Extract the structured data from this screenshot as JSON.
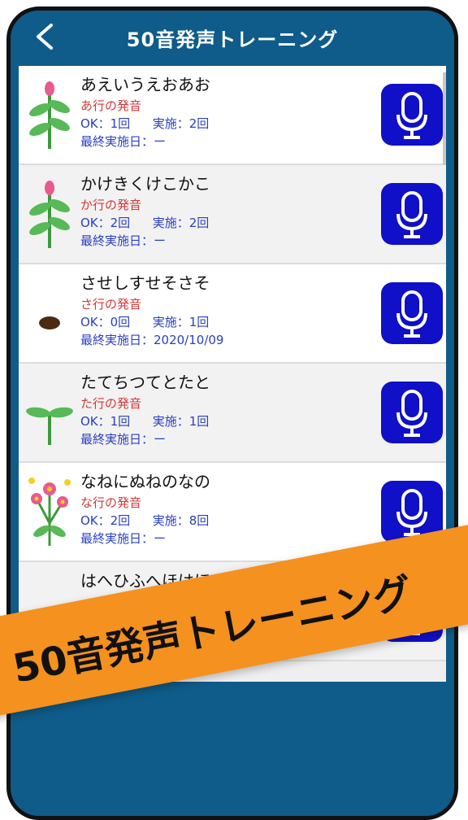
{
  "header": {
    "title": "50音発声トレーニング"
  },
  "items": [
    {
      "kana": "あえいうえおあお",
      "row_label": "あ行の発音",
      "ok": "OK：1回",
      "done": "実施：2回",
      "last": "最終実施日：ー"
    },
    {
      "kana": "かけきくけこかこ",
      "row_label": "か行の発音",
      "ok": "OK：2回",
      "done": "実施：2回",
      "last": "最終実施日：ー"
    },
    {
      "kana": "させしすせそさそ",
      "row_label": "さ行の発音",
      "ok": "OK：0回",
      "done": "実施：1回",
      "last": "最終実施日：2020/10/09"
    },
    {
      "kana": "たてちつてとたと",
      "row_label": "た行の発音",
      "ok": "OK：1回",
      "done": "実施：1回",
      "last": "最終実施日：ー"
    },
    {
      "kana": "なねにぬねのなの",
      "row_label": "な行の発音",
      "ok": "OK：2回",
      "done": "実施：8回",
      "last": "最終実施日：ー"
    },
    {
      "kana": "はへひふへほはほ"
    }
  ],
  "banner": {
    "text": "50音発声トレーニング"
  },
  "colors": {
    "header": "#0f5c8a",
    "mic": "#1010c8",
    "red_text": "#d43737",
    "blue_text": "#2a3fbf",
    "banner": "#f5911e"
  },
  "icons": {
    "back": "chevron-left-icon",
    "mic": "microphone-icon",
    "plant": "plant-icon"
  }
}
